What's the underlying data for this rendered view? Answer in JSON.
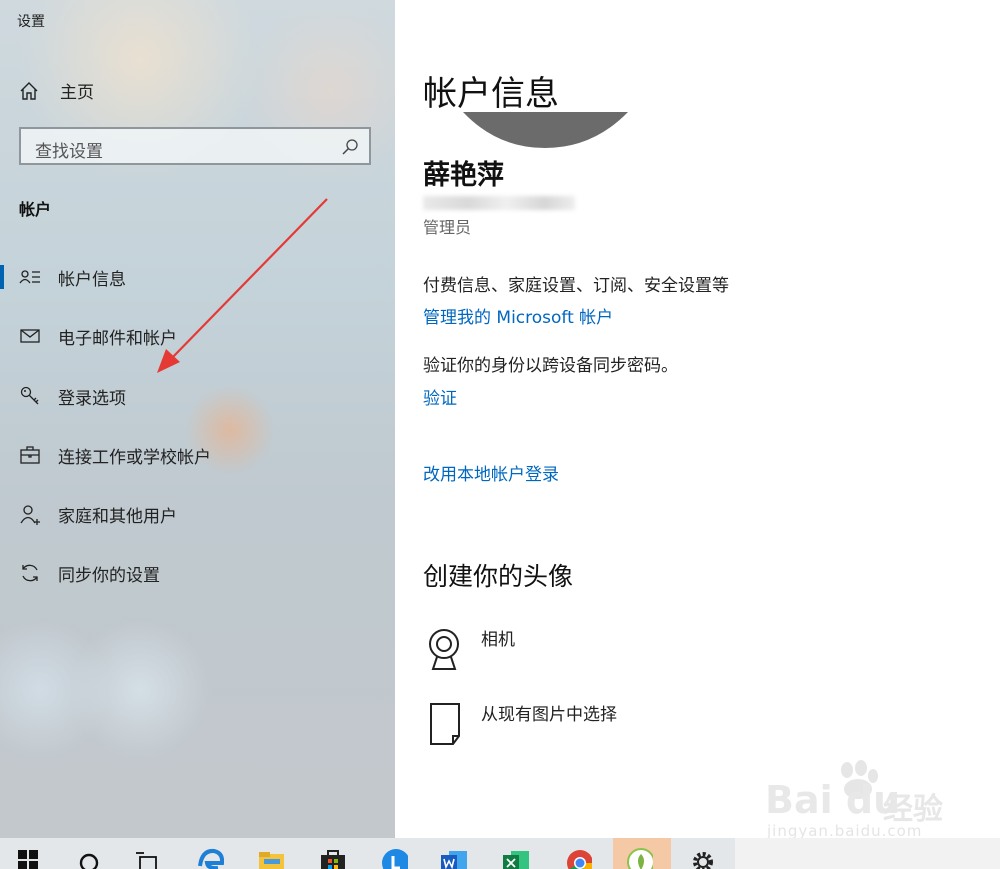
{
  "window": {
    "title": "设置"
  },
  "sidebar": {
    "home_label": "主页",
    "search_placeholder": "查找设置",
    "section_title": "帐户",
    "items": [
      {
        "label": "帐户信息",
        "icon": "account-info-icon",
        "selected": true
      },
      {
        "label": "电子邮件和帐户",
        "icon": "mail-icon",
        "selected": false
      },
      {
        "label": "登录选项",
        "icon": "key-icon",
        "selected": false
      },
      {
        "label": "连接工作或学校帐户",
        "icon": "briefcase-icon",
        "selected": false
      },
      {
        "label": "家庭和其他用户",
        "icon": "add-person-icon",
        "selected": false
      },
      {
        "label": "同步你的设置",
        "icon": "sync-icon",
        "selected": false
      }
    ]
  },
  "main": {
    "title": "帐户信息",
    "user_name": "薛艳萍",
    "role": "管理员",
    "billing_text": "付费信息、家庭设置、订阅、安全设置等",
    "manage_link": "管理我的 Microsoft 帐户",
    "verify_text": "验证你的身份以跨设备同步密码。",
    "verify_link": "验证",
    "local_account_link": "改用本地帐户登录",
    "create_avatar_heading": "创建你的头像",
    "options": [
      {
        "label": "相机",
        "icon": "webcam-icon"
      },
      {
        "label": "从现有图片中选择",
        "icon": "document-icon"
      }
    ]
  },
  "watermark": {
    "logo": "Bai du",
    "cn": "经验",
    "url": "jingyan.baidu.com"
  },
  "taskbar": {
    "items": [
      "start",
      "search",
      "task-view",
      "edge",
      "file-explorer",
      "store",
      "l-app",
      "word",
      "excel",
      "chrome",
      "green-app",
      "settings"
    ]
  },
  "colors": {
    "accent": "#0063b1",
    "link": "#0067c0",
    "arrow": "#e53935"
  }
}
